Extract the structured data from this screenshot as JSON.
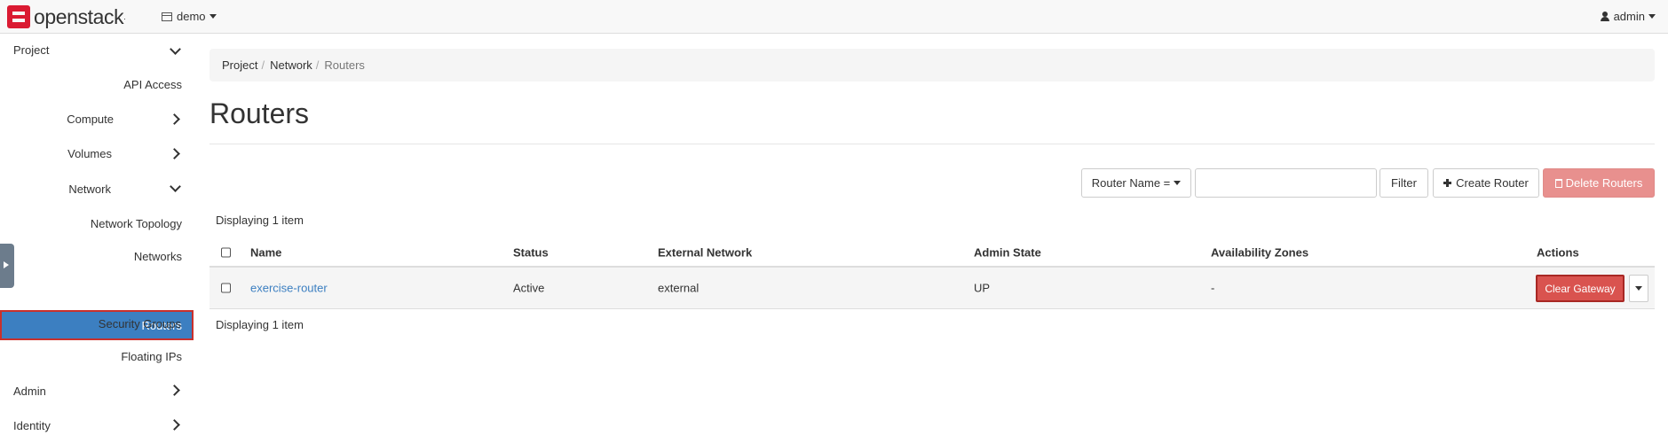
{
  "navbar": {
    "brand": "openstack",
    "project": "demo",
    "user": "admin"
  },
  "sidebar": {
    "items": [
      {
        "label": "Project"
      },
      {
        "label": "API Access"
      },
      {
        "label": "Compute"
      },
      {
        "label": "Volumes"
      },
      {
        "label": "Network"
      },
      {
        "label": "Network Topology"
      },
      {
        "label": "Networks"
      },
      {
        "label": "Routers"
      },
      {
        "label": "Security Groups"
      },
      {
        "label": "Floating IPs"
      },
      {
        "label": "Admin"
      },
      {
        "label": "Identity"
      }
    ]
  },
  "breadcrumb": {
    "items": [
      "Project",
      "Network",
      "Routers"
    ],
    "separator": "/"
  },
  "page": {
    "title": "Routers"
  },
  "toolbar": {
    "filter_select": "Router Name =",
    "filter_value": "",
    "filter_button": "Filter",
    "create_button": "Create Router",
    "delete_button": "Delete Routers"
  },
  "table": {
    "count_top": "Displaying 1 item",
    "count_bottom": "Displaying 1 item",
    "columns": [
      "Name",
      "Status",
      "External Network",
      "Admin State",
      "Availability Zones",
      "Actions"
    ],
    "rows": [
      {
        "name": "exercise-router",
        "status": "Active",
        "external_network": "external",
        "admin_state": "UP",
        "availability_zones": "-",
        "action": "Clear Gateway"
      }
    ]
  },
  "colors": {
    "active_nav": "#3c7fc1",
    "danger": "#d9534f",
    "brand": "#da1a32"
  }
}
